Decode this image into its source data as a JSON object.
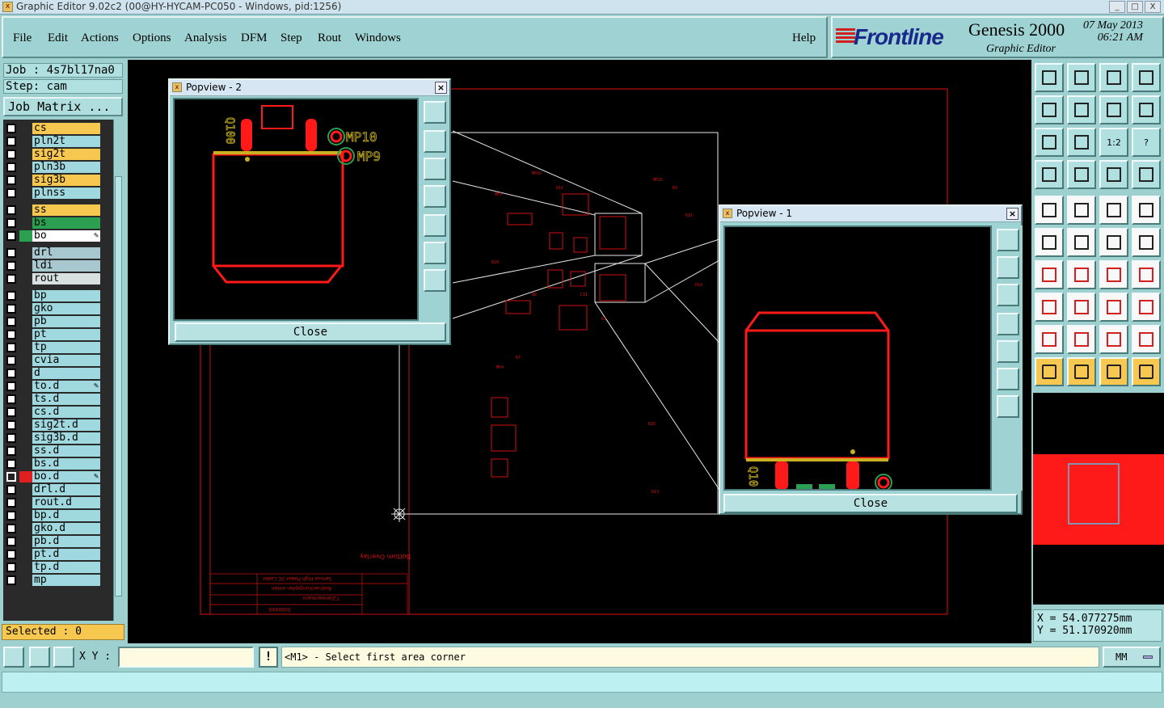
{
  "window": {
    "title": "Graphic Editor 9.02c2 (00@HY-HYCAM-PC050 - Windows, pid:1256)",
    "controls": [
      "_",
      "□",
      "X"
    ]
  },
  "menu": {
    "items": [
      "File",
      "Edit",
      "Actions",
      "Options",
      "Analysis",
      "DFM",
      "Step",
      "Rout",
      "Windows"
    ],
    "help": "Help"
  },
  "brand": {
    "logo": "Frontline",
    "product": "Genesis 2000",
    "subtitle": "Graphic Editor",
    "date": "07 May 2013",
    "time": "06:21 AM"
  },
  "job": {
    "job_line": "Job : 4s7bl17na0",
    "step_line": "Step: cam",
    "matrix_button": "Job Matrix ..."
  },
  "layers": [
    {
      "name": "cs",
      "color": "#f6c850"
    },
    {
      "name": "pln2t",
      "color": "#a0d8e0"
    },
    {
      "name": "sig2t",
      "color": "#f6c850"
    },
    {
      "name": "pln3b",
      "color": "#a0d8e0"
    },
    {
      "name": "sig3b",
      "color": "#f6c850"
    },
    {
      "name": "plnss",
      "color": "#a0d8e0"
    },
    {
      "name": "ss",
      "color": "#f6c850"
    },
    {
      "name": "bs",
      "color": "#2aa050"
    },
    {
      "name": "bo",
      "color": "#ffffff",
      "swatch": "#2aa050",
      "icon": "pencil"
    },
    {
      "name": "drl",
      "color": "#a8c8d0"
    },
    {
      "name": "ldi",
      "color": "#a8c8d0"
    },
    {
      "name": "rout",
      "color": "#d8e0e0"
    },
    {
      "name": "bp",
      "color": "#a0d8e0"
    },
    {
      "name": "gko",
      "color": "#a0d8e0"
    },
    {
      "name": "pb",
      "color": "#a0d8e0"
    },
    {
      "name": "pt",
      "color": "#a0d8e0"
    },
    {
      "name": "tp",
      "color": "#a0d8e0"
    },
    {
      "name": "cvia",
      "color": "#a0d8e0"
    },
    {
      "name": "d",
      "color": "#a0d8e0"
    },
    {
      "name": "to.d",
      "color": "#a0d8e0",
      "icon": "pencil"
    },
    {
      "name": "ts.d",
      "color": "#a0d8e0"
    },
    {
      "name": "cs.d",
      "color": "#a0d8e0"
    },
    {
      "name": "sig2t.d",
      "color": "#a0d8e0"
    },
    {
      "name": "sig3b.d",
      "color": "#a0d8e0"
    },
    {
      "name": "ss.d",
      "color": "#a0d8e0"
    },
    {
      "name": "bs.d",
      "color": "#a0d8e0"
    },
    {
      "name": "bo.d",
      "color": "#a0d8e0",
      "swatch": "#e02020",
      "icon": "pencil",
      "active": true
    },
    {
      "name": "drl.d",
      "color": "#a0d8e0"
    },
    {
      "name": "rout.d",
      "color": "#a0d8e0"
    },
    {
      "name": "bp.d",
      "color": "#a0d8e0"
    },
    {
      "name": "gko.d",
      "color": "#a0d8e0"
    },
    {
      "name": "pb.d",
      "color": "#a0d8e0"
    },
    {
      "name": "pt.d",
      "color": "#a0d8e0"
    },
    {
      "name": "tp.d",
      "color": "#a0d8e0"
    },
    {
      "name": "mp",
      "color": "#a0d8e0"
    }
  ],
  "selected": "Selected : 0",
  "canvas": {
    "board_label": "Bottom Overlay",
    "title_block": [
      "Servus High Power SC Lader",
      "Bestueckungsplan unten",
      "T.Zimmermann",
      "3000XXX"
    ]
  },
  "popview2": {
    "title": "Popview - 2",
    "close_label": "Close",
    "labels": [
      "MP10",
      "MP9",
      "Q100"
    ]
  },
  "popview1": {
    "title": "Popview - 1",
    "close_label": "Close",
    "labels": [
      "Q10"
    ]
  },
  "toolbox": {
    "ratio_label": "1:2",
    "help_label": "?"
  },
  "coords": {
    "x": "X  =  54.077275mm",
    "y": "Y  =  51.170920mm"
  },
  "status": {
    "xy_label": "X Y :",
    "xy_value": "",
    "bang": "!",
    "prompt": "<M1> - Select first area corner",
    "units": "MM"
  },
  "colors": {
    "accent": "#9fd3d3",
    "layer_orange": "#f6c850",
    "trace_red": "#ff1a1a",
    "pad_olive": "#c8b020"
  }
}
